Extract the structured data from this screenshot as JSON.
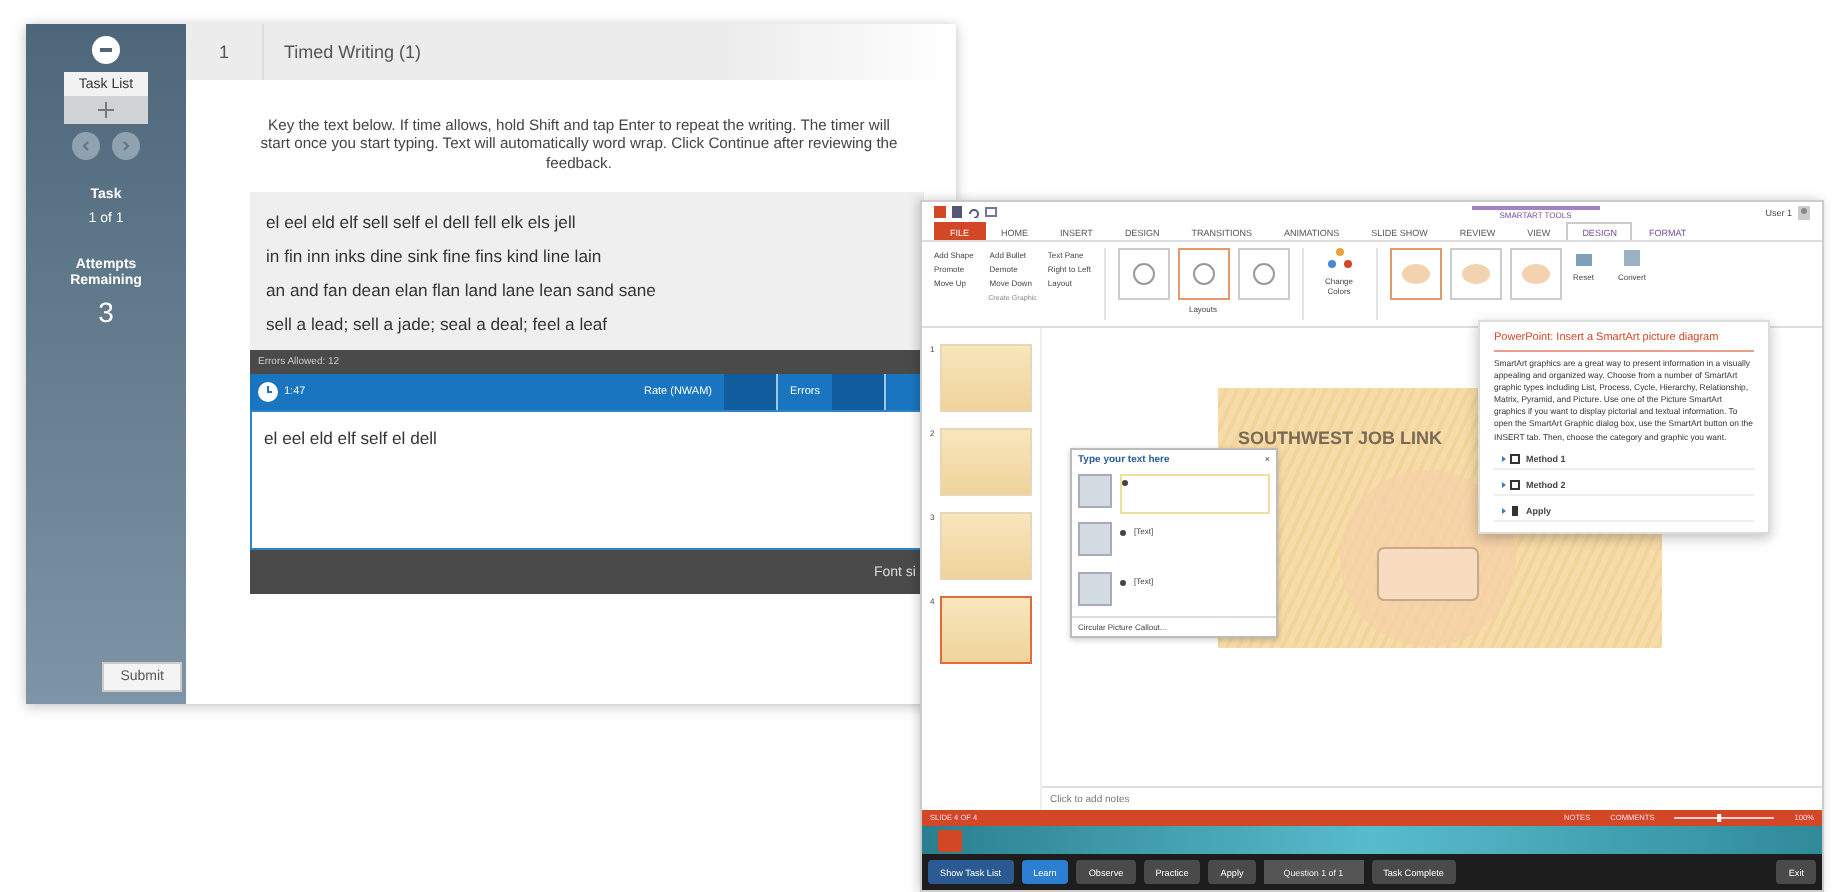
{
  "typing_window": {
    "sidebar": {
      "task_list": "Task List",
      "task_label": "Task",
      "task_value": "1 of 1",
      "attempts_label": "Attempts Remaining",
      "attempts_value": "3",
      "submit": "Submit"
    },
    "header": {
      "number": "1",
      "title": "Timed Writing (1)"
    },
    "instructions": "Key the text below. If time allows, hold Shift and tap Enter to repeat the writing. The timer will start once you start typing. Text will automatically word wrap. Click Continue after reviewing the feedback.",
    "passage": [
      "el eel eld elf sell self el dell fell elk els jell",
      "in fin inn inks dine sink fine fins kind line lain",
      "an and fan dean elan flan land lane lean sand sane",
      "sell a lead; sell a jade; seal a deal; feel a leaf"
    ],
    "errors_allowed": "Errors Allowed: 12",
    "timer": "1:47",
    "columns": [
      "Rate (NWAM)",
      "Errors"
    ],
    "typed_text": "el eel eld elf self el dell",
    "footer_text": "Font si"
  },
  "powerpoint_window": {
    "user": "User 1",
    "contextual_group": "SMARTART TOOLS",
    "tabs": [
      {
        "label": "FILE",
        "kind": "file",
        "selected": false
      },
      {
        "label": "HOME",
        "kind": "normal",
        "selected": false
      },
      {
        "label": "INSERT",
        "kind": "normal",
        "selected": false
      },
      {
        "label": "DESIGN",
        "kind": "normal",
        "selected": false
      },
      {
        "label": "TRANSITIONS",
        "kind": "normal",
        "selected": false
      },
      {
        "label": "ANIMATIONS",
        "kind": "normal",
        "selected": false
      },
      {
        "label": "SLIDE SHOW",
        "kind": "normal",
        "selected": false
      },
      {
        "label": "REVIEW",
        "kind": "normal",
        "selected": false
      },
      {
        "label": "VIEW",
        "kind": "normal",
        "selected": false
      },
      {
        "label": "DESIGN",
        "kind": "contextual",
        "selected": true
      },
      {
        "label": "FORMAT",
        "kind": "contextual",
        "selected": false
      }
    ],
    "ribbon": {
      "create_graphic": [
        "Add Shape",
        "Add Bullet",
        "Text Pane",
        "Promote",
        "Demote",
        "Right to Left",
        "Move Up",
        "Move Down",
        "Layout"
      ],
      "create_graphic_label": "Create Graphic",
      "layouts_label": "Layouts",
      "change_colors": "Change Colors",
      "reset": "Reset",
      "convert": "Convert",
      "layouts": [
        {
          "selected": false
        },
        {
          "selected": true
        },
        {
          "selected": false
        }
      ],
      "styles": [
        {
          "selected": true
        },
        {
          "selected": false
        },
        {
          "selected": false
        }
      ]
    },
    "thumbnails": [
      {
        "number": "1",
        "selected": false
      },
      {
        "number": "2",
        "selected": false
      },
      {
        "number": "3",
        "selected": false
      },
      {
        "number": "4",
        "selected": true
      }
    ],
    "slide_title": "SOUTHWEST JOB LINK",
    "text_pane": {
      "title": "Type your text here",
      "close": "×",
      "items": [
        "[Text]",
        "[Text]"
      ],
      "footer": "Circular Picture Callout..."
    },
    "tooltip": {
      "title": "PowerPoint: Insert a SmartArt picture diagram",
      "body": "SmartArt graphics are a great way to present information in a visually appealing and organized way. Choose from a number of SmartArt graphic types including List, Process, Cycle, Hierarchy, Relationship, Matrix, Pyramid, and Picture. Use one of the Picture SmartArt graphics if you want to display pictorial and textual information. To open the SmartArt Graphic dialog box, use the SmartArt button on the INSERT tab. Then, choose the category and graphic you want.",
      "methods": [
        {
          "label": "Method 1",
          "kind": "method"
        },
        {
          "label": "Method 2",
          "kind": "method"
        },
        {
          "label": "Apply",
          "kind": "apply"
        }
      ]
    },
    "notes": "Click to add notes",
    "status": {
      "slide": "SLIDE 4 OF 4",
      "notes": "NOTES",
      "comments": "COMMENTS",
      "zoom": "100%",
      "zoom_slider": {
        "level": 0.45
      }
    },
    "taskbar": {
      "show_task_list": "Show Task List",
      "modes": [
        {
          "label": "Learn",
          "selected": true
        },
        {
          "label": "Observe",
          "selected": false
        },
        {
          "label": "Practice",
          "selected": false
        },
        {
          "label": "Apply",
          "selected": false
        }
      ],
      "question": "Question 1 of 1",
      "task_complete": "Task Complete",
      "exit": "Exit"
    }
  }
}
